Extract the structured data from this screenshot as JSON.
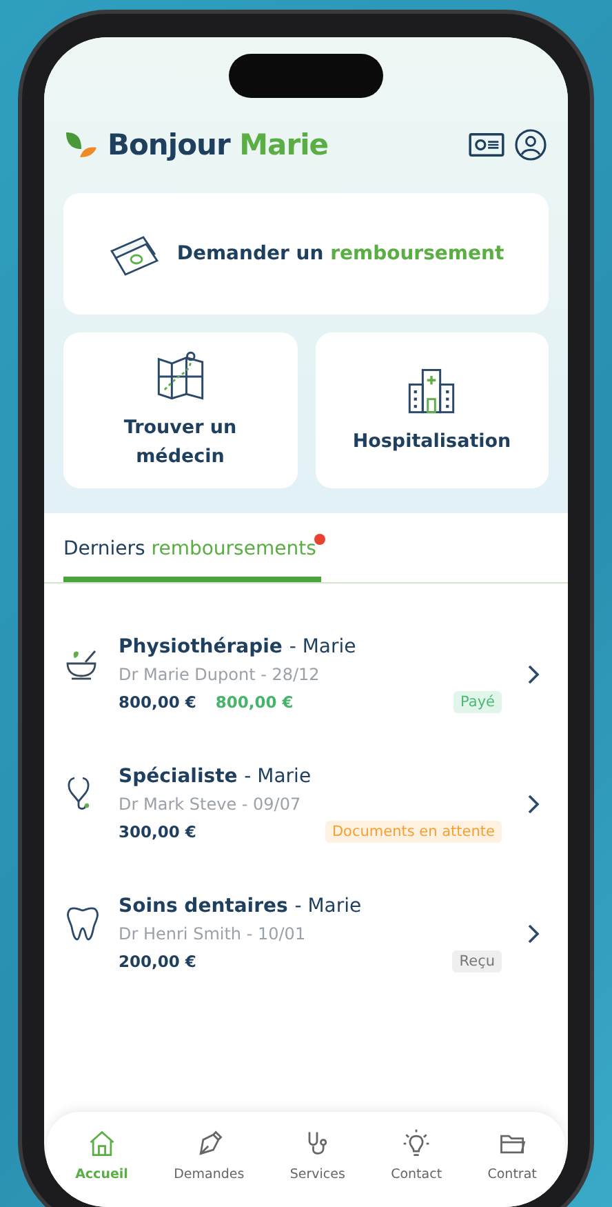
{
  "header": {
    "greeting": "Bonjour",
    "name": "Marie"
  },
  "actions": [
    {
      "kind": "refund",
      "text": "Demander un",
      "highlight": "remboursement"
    },
    {
      "kind": "map",
      "text": "Trouver un médecin"
    },
    {
      "kind": "hospital",
      "text": "Hospitalisation"
    }
  ],
  "tab": {
    "text": "Derniers",
    "highlight": "remboursements",
    "notification": true,
    "selected": true
  },
  "rows": [
    {
      "kind": "physio",
      "title": "Physiothérapie",
      "person": "- Marie",
      "detail": "Dr Marie Dupont - 28/12",
      "amount": "800,00 €",
      "refunded": "800,00 €",
      "status": {
        "text": "Payé",
        "kind": "paid"
      }
    },
    {
      "kind": "specialist",
      "title": "Spécialiste",
      "person": "- Marie",
      "detail": "Dr Mark Steve - 09/07",
      "amount": "300,00 €",
      "status": {
        "text": "Documents en attente",
        "kind": "pending"
      }
    },
    {
      "kind": "dental",
      "title": "Soins dentaires",
      "person": "- Marie",
      "detail": "Dr Henri Smith - 10/01",
      "amount": "200,00 €",
      "status": {
        "text": "Reçu",
        "kind": "received"
      }
    }
  ],
  "nav": [
    {
      "kind": "home",
      "label": "Accueil",
      "selected": true
    },
    {
      "kind": "pen",
      "label": "Demandes",
      "selected": false
    },
    {
      "kind": "stethoscope",
      "label": "Services",
      "selected": false
    },
    {
      "kind": "bulb",
      "label": "Contact",
      "selected": false
    },
    {
      "kind": "folder",
      "label": "Contrat",
      "selected": false
    }
  ]
}
